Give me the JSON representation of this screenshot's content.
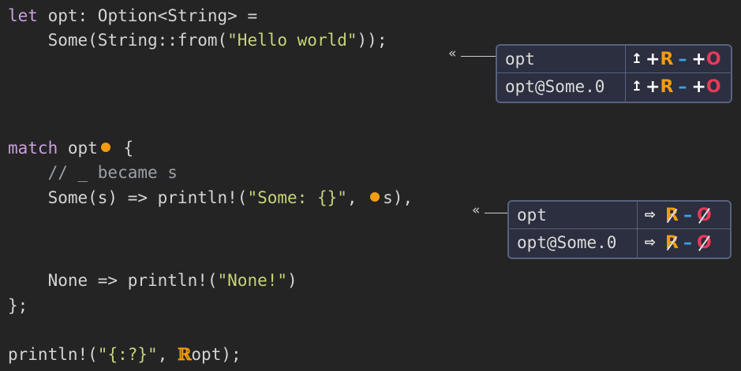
{
  "code": {
    "line1": {
      "kw": "let",
      "rest": " opt: Option<String> ="
    },
    "line2": {
      "pre": "    Some(String::from(",
      "str": "\"Hello world\"",
      "post": "));"
    },
    "line5": {
      "kw": "match",
      "id": " opt",
      "post": " {"
    },
    "line6": {
      "comment": "    // _ became s"
    },
    "line7": {
      "pre": "    Some(s) => println!(",
      "str": "\"Some: {}\"",
      "mid": ", ",
      "id": "s",
      "post": "),"
    },
    "line10": {
      "pre": "    None => println!(",
      "str": "\"None!\"",
      "post": ")"
    },
    "line11": {
      "text": "};"
    },
    "line13": {
      "pre": "println!(",
      "str": "\"{:?}\"",
      "mid": ", ",
      "rglyph": "ℝ",
      "id": "opt",
      "post": ");"
    }
  },
  "boxes": {
    "top": {
      "chevron": "«",
      "rows": [
        {
          "path": "opt",
          "icon": "↥",
          "plus_r": "+",
          "r": "R",
          "w": "–",
          "plus_o": "+",
          "o": "O"
        },
        {
          "path": "opt@Some.0",
          "icon": "↥",
          "plus_r": "+",
          "r": "R",
          "w": "–",
          "plus_o": "+",
          "o": "O"
        }
      ]
    },
    "bottom": {
      "chevron": "«",
      "rows": [
        {
          "path": "opt",
          "icon": "⇨",
          "r": "R",
          "w": "–",
          "o": "O"
        },
        {
          "path": "opt@Some.0",
          "icon": "⇨",
          "r": "R",
          "w": "–",
          "o": "O"
        }
      ]
    }
  },
  "colors": {
    "background": "#242424",
    "read": "#f39c12",
    "write": "#3ba0e6",
    "own": "#e63a5a",
    "string": "#c8d27a",
    "keyword": "#c9a0dc"
  }
}
